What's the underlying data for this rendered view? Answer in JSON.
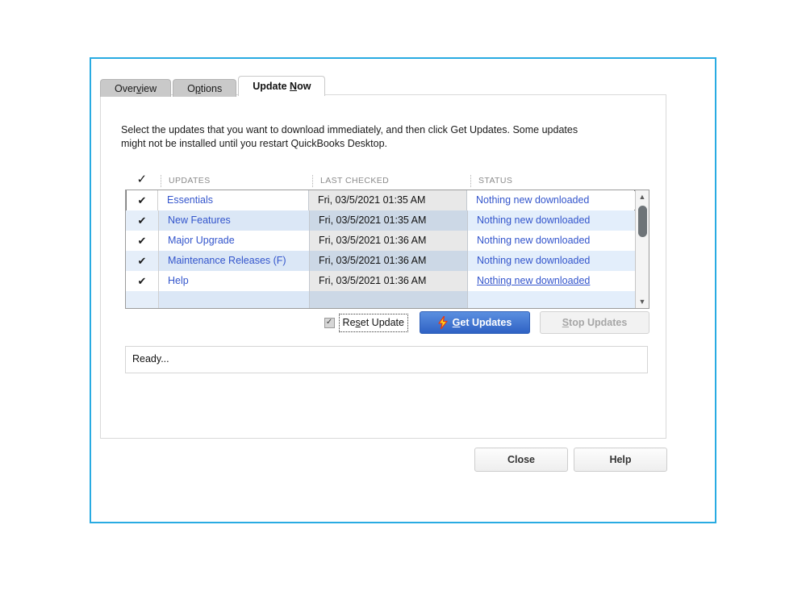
{
  "window": {
    "accent_color": "#29abe2"
  },
  "tabs": [
    {
      "label_pre": "Over",
      "accel": "v",
      "label_post": "iew",
      "name": "overview",
      "active": false
    },
    {
      "label_pre": "O",
      "accel": "p",
      "label_post": "tions",
      "name": "options",
      "active": false
    },
    {
      "label_pre": "Update ",
      "accel": "N",
      "label_post": "ow",
      "name": "update-now",
      "active": true
    }
  ],
  "panel": {
    "intro": "Select the updates that you want to download immediately, and then click Get Updates. Some updates might not be installed until you restart QuickBooks Desktop."
  },
  "grid": {
    "headers": {
      "check": "✓",
      "updates": "UPDATES",
      "last_checked": "LAST CHECKED",
      "status": "STATUS"
    },
    "rows": [
      {
        "checked": "✔",
        "name": "Essentials",
        "last_checked": "Fri, 03/5/2021 01:35 AM",
        "status": "Nothing new downloaded",
        "selected": true,
        "underline": false
      },
      {
        "checked": "✔",
        "name": "New Features",
        "last_checked": "Fri, 03/5/2021 01:35 AM",
        "status": "Nothing new downloaded",
        "selected": false,
        "underline": false
      },
      {
        "checked": "✔",
        "name": "Major Upgrade",
        "last_checked": "Fri, 03/5/2021 01:36 AM",
        "status": "Nothing new downloaded",
        "selected": false,
        "underline": false
      },
      {
        "checked": "✔",
        "name": "Maintenance Releases (F)",
        "last_checked": "Fri, 03/5/2021 01:36 AM",
        "status": "Nothing new downloaded",
        "selected": false,
        "underline": false
      },
      {
        "checked": "✔",
        "name": "Help",
        "last_checked": "Fri, 03/5/2021 01:36 AM",
        "status": "Nothing new downloaded",
        "selected": false,
        "underline": true
      }
    ],
    "scrollbar": {
      "up_arrow": "▲",
      "down_arrow": "▼"
    }
  },
  "actions": {
    "reset_checked": true,
    "reset_check_glyph": "✓",
    "reset_pre": "Re",
    "reset_accel": "s",
    "reset_post": "et Update",
    "get_updates_pre": "",
    "get_updates_accel": "G",
    "get_updates_post": "et Updates",
    "stop_updates_accel": "S",
    "stop_updates_post": "top Updates"
  },
  "status": {
    "text": "Ready..."
  },
  "footer": {
    "close": "Close",
    "help": "Help"
  }
}
